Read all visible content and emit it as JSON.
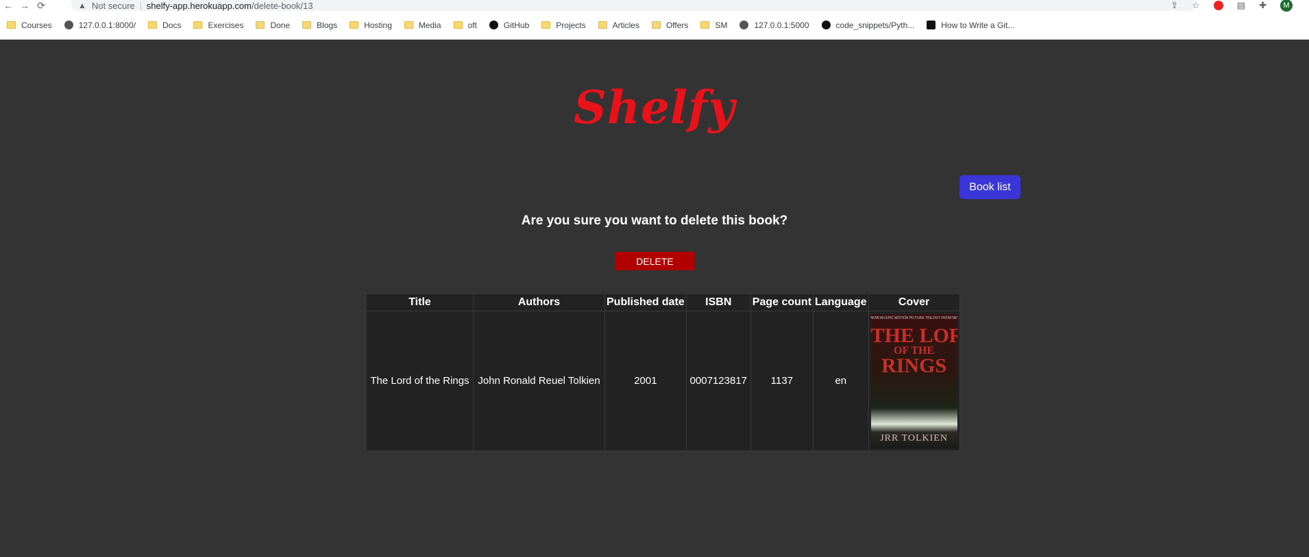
{
  "browser": {
    "security_label": "Not secure",
    "url_host": "shelfy-app.herokuapp.com",
    "url_path": "/delete-book/13",
    "profile_initial": "M"
  },
  "bookmarks": [
    {
      "label": "Courses",
      "icon": "folder-icon"
    },
    {
      "label": "127.0.0.1:8000/",
      "icon": "globe-icon"
    },
    {
      "label": "Docs",
      "icon": "folder-icon"
    },
    {
      "label": "Exercises",
      "icon": "folder-icon"
    },
    {
      "label": "Done",
      "icon": "folder-icon"
    },
    {
      "label": "Blogs",
      "icon": "folder-icon"
    },
    {
      "label": "Hosting",
      "icon": "folder-icon"
    },
    {
      "label": "Media",
      "icon": "folder-icon"
    },
    {
      "label": "oft",
      "icon": "folder-icon"
    },
    {
      "label": "GitHub",
      "icon": "github-icon"
    },
    {
      "label": "Projects",
      "icon": "folder-icon"
    },
    {
      "label": "Articles",
      "icon": "folder-icon"
    },
    {
      "label": "Offers",
      "icon": "folder-icon"
    },
    {
      "label": "SM",
      "icon": "folder-icon"
    },
    {
      "label": "127.0.0.1:5000",
      "icon": "globe-icon"
    },
    {
      "label": "code_snippets/Pyth...",
      "icon": "github-icon"
    },
    {
      "label": "How to Write a Git...",
      "icon": "doc-icon"
    }
  ],
  "app": {
    "logo": "Shelfy",
    "book_list_label": "Book list",
    "question": "Are you sure you want to delete this book?",
    "delete_label": "DELETE"
  },
  "table": {
    "headers": [
      "Title",
      "Authors",
      "Published date",
      "ISBN",
      "Page count",
      "Language",
      "Cover"
    ],
    "row": {
      "title": "The Lord of the Rings",
      "authors": "John Ronald Reuel Tolkien",
      "published_date": "2001",
      "isbn": "0007123817",
      "page_count": "1137",
      "language": "en"
    },
    "cover": {
      "tagline": "NOW AN EPIC MOTION PICTURE TRILOGY FROM NEW LINE CINEMA",
      "title_line1": "THE LORD",
      "title_line2": "OF THE",
      "title_line3": "RINGS",
      "author": "JRR TOLKIEN"
    }
  }
}
